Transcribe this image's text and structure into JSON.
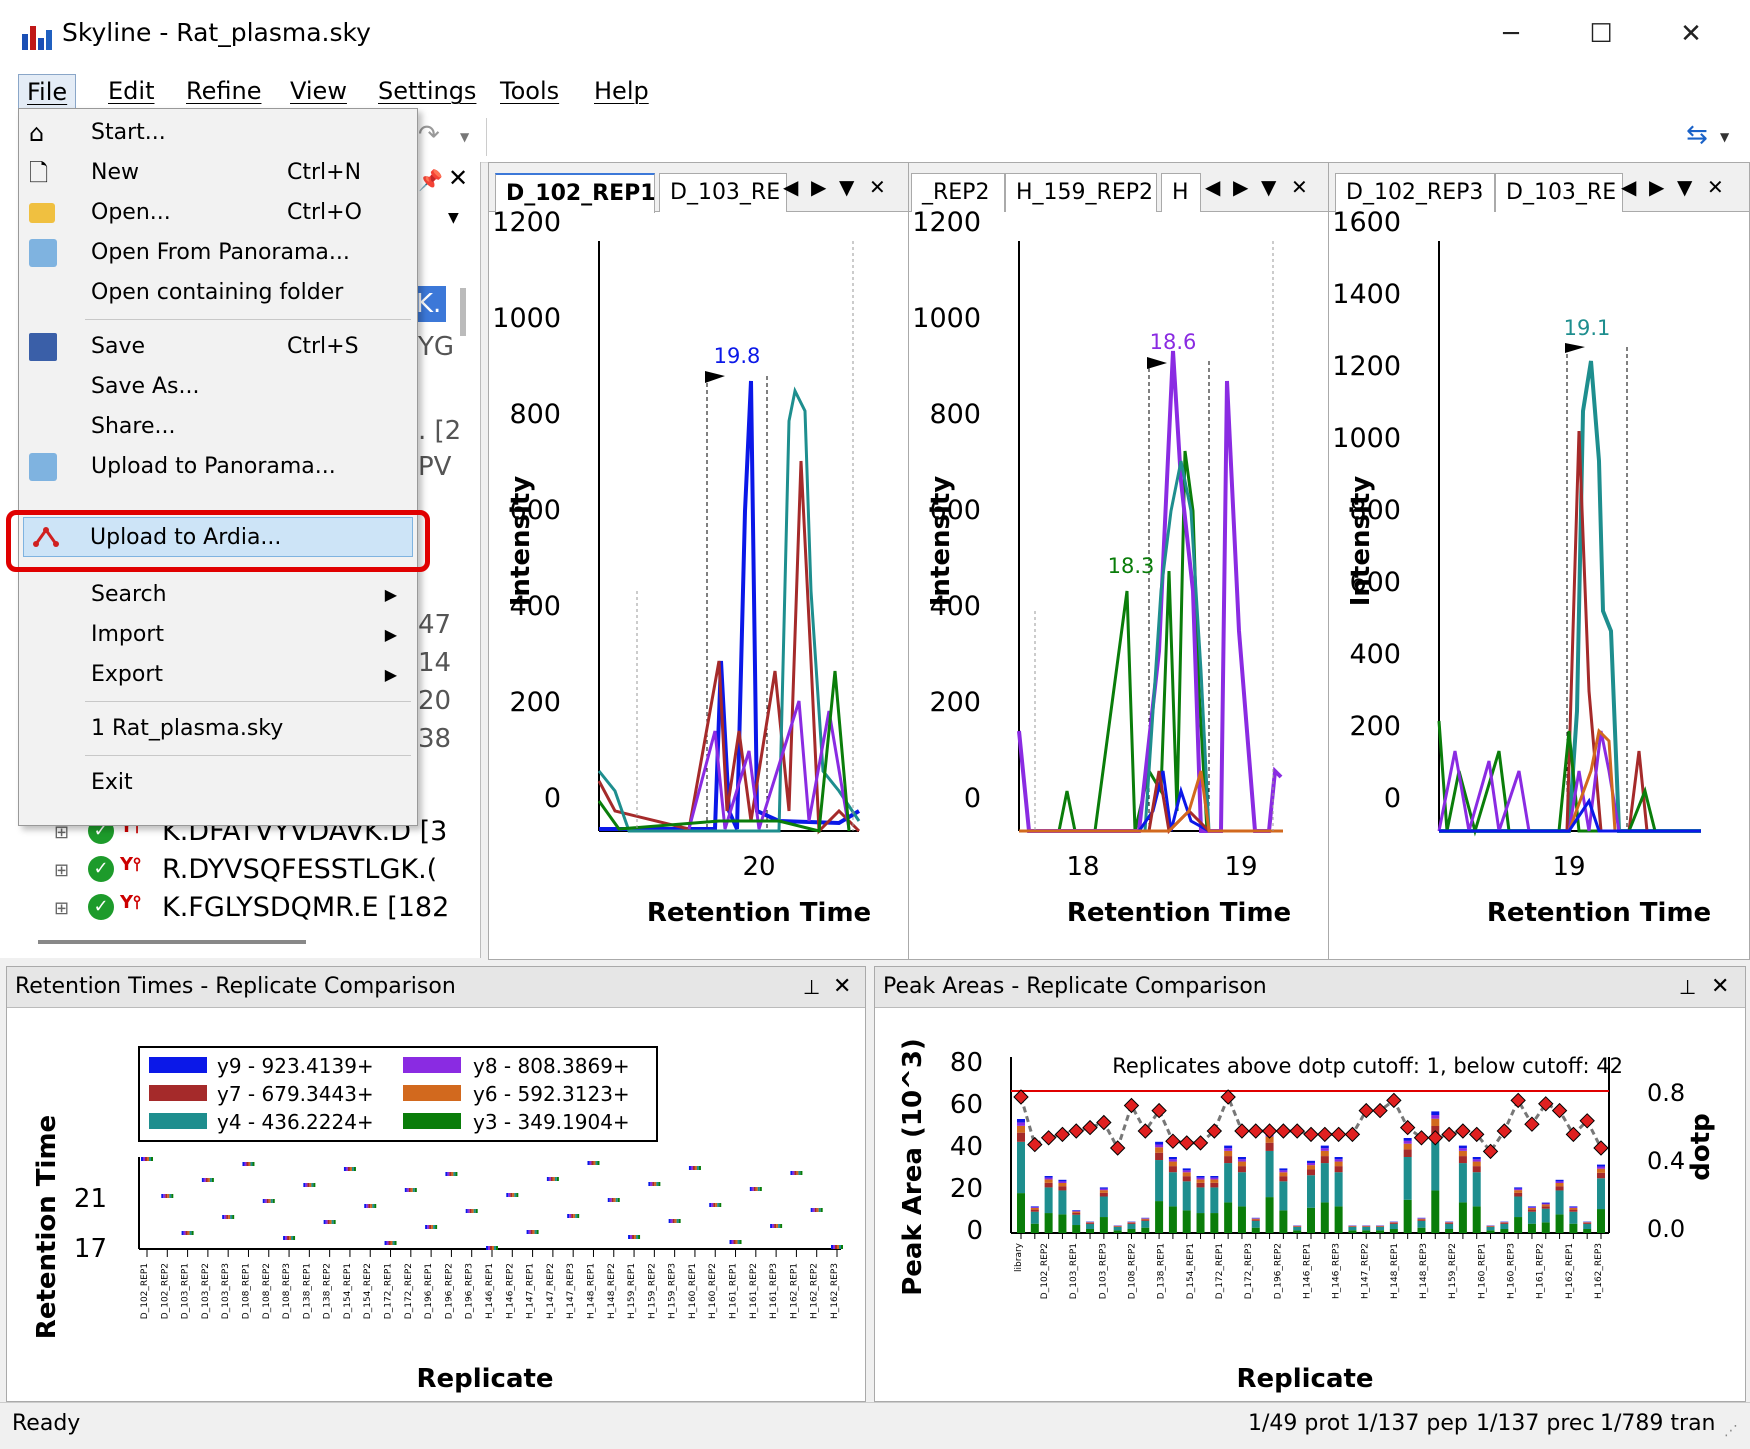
{
  "window": {
    "title": "Skyline - Rat_plasma.sky",
    "controls": [
      "─",
      "☐",
      "✕"
    ]
  },
  "menubar": [
    "File",
    "Edit",
    "Refine",
    "View",
    "Settings",
    "Tools",
    "Help"
  ],
  "file_menu": {
    "items": [
      {
        "label": "Start...",
        "shortcut": "",
        "icon": "home-icon"
      },
      {
        "label": "New",
        "shortcut": "Ctrl+N",
        "icon": "new-document-icon"
      },
      {
        "label": "Open...",
        "shortcut": "Ctrl+O",
        "icon": "open-folder-icon"
      },
      {
        "label": "Open From Panorama...",
        "shortcut": "",
        "icon": "panorama-open-icon"
      },
      {
        "label": "Open containing folder",
        "shortcut": "",
        "icon": ""
      },
      {
        "label": "Save",
        "shortcut": "Ctrl+S",
        "icon": "save-disk-icon"
      },
      {
        "label": "Save As...",
        "shortcut": "",
        "icon": ""
      },
      {
        "label": "Share...",
        "shortcut": "",
        "icon": ""
      },
      {
        "label": "Upload to Panorama...",
        "shortcut": "",
        "icon": "panorama-upload-icon"
      },
      {
        "label": "Upload to Ardia...",
        "shortcut": "",
        "icon": "ardia-icon",
        "highlighted": true
      },
      {
        "label": "Search",
        "shortcut": "",
        "submenu": true
      },
      {
        "label": "Import",
        "shortcut": "",
        "submenu": true
      },
      {
        "label": "Export",
        "shortcut": "",
        "submenu": true
      },
      {
        "label": "1 Rat_plasma.sky",
        "shortcut": ""
      },
      {
        "label": "Exit",
        "shortcut": ""
      }
    ],
    "submenu_arrow": "▶"
  },
  "tree": {
    "visible_rows": [
      {
        "text": "K.DFATVYVDAVK.D [3"
      },
      {
        "text": "R.DYVSQFESSTLGK.("
      },
      {
        "text": "K.FGLYSDQMR.E [182"
      }
    ],
    "clipped_fragments": [
      "K.",
      "YG",
      ". [2",
      "PV",
      "47",
      "14",
      "20",
      "38"
    ],
    "expander": "⊞"
  },
  "graph_panes": [
    {
      "tabs": [
        "D_102_REP1",
        "D_103_RE"
      ],
      "y_title": "Intensity",
      "x_title": "Retention Time",
      "peak_label": "19.8",
      "y_ticks": [
        "1200",
        "1000",
        "800",
        "600",
        "400",
        "200",
        "0"
      ],
      "x_ticks": [
        "20"
      ]
    },
    {
      "tabs": [
        "_REP2",
        "H_159_REP2",
        "H"
      ],
      "y_title": "Intensity",
      "x_title": "Retention Time",
      "peak_label": "18.6",
      "peak_label_2": "18.3",
      "y_ticks": [
        "1200",
        "1000",
        "800",
        "600",
        "400",
        "200",
        "0"
      ],
      "x_ticks": [
        "18",
        "19"
      ]
    },
    {
      "tabs": [
        "D_102_REP3",
        "D_103_RE"
      ],
      "y_title": "Intensity",
      "x_title": "Retention Time",
      "peak_label": "19.1",
      "y_ticks": [
        "1600",
        "1400",
        "1200",
        "1000",
        "800",
        "600",
        "400",
        "200",
        "0"
      ],
      "x_ticks": [
        "19"
      ]
    }
  ],
  "tab_controls": [
    "◀",
    "▶",
    "▼",
    "✕"
  ],
  "rt_panel": {
    "title": "Retention Times - Replicate Comparison",
    "y_title": "Retention Time",
    "x_title": "Replicate",
    "y_ticks": [
      "21",
      "17"
    ],
    "legend": [
      {
        "label": "y9 - 923.4139+",
        "color": "#0b18e8"
      },
      {
        "label": "y8 - 808.3869+",
        "color": "#8a2be2"
      },
      {
        "label": "y7 - 679.3443+",
        "color": "#a52a2a"
      },
      {
        "label": "y6 - 592.3123+",
        "color": "#d2691e"
      },
      {
        "label": "y4 - 436.2224+",
        "color": "#1e8e8e"
      },
      {
        "label": "y3 - 349.1904+",
        "color": "#0a7d0a"
      }
    ],
    "replicates": [
      "D_102_REP1",
      "D_102_REP2",
      "D_103_REP1",
      "D_103_REP2",
      "D_103_REP3",
      "D_108_REP1",
      "D_108_REP2",
      "D_108_REP3",
      "D_138_REP1",
      "D_138_REP2",
      "D_154_REP1",
      "D_154_REP2",
      "D_172_REP1",
      "D_172_REP2",
      "D_196_REP1",
      "D_196_REP2",
      "D_196_REP3",
      "H_146_REP1",
      "H_146_REP2",
      "H_147_REP1",
      "H_147_REP2",
      "H_147_REP3",
      "H_148_REP1",
      "H_148_REP2",
      "H_159_REP1",
      "H_159_REP2",
      "H_159_REP3",
      "H_160_REP1",
      "H_160_REP2",
      "H_161_REP1",
      "H_161_REP2",
      "H_161_REP3",
      "H_162_REP1",
      "H_162_REP2",
      "H_162_REP3"
    ]
  },
  "pa_panel": {
    "title": "Peak Areas - Replicate Comparison",
    "y_title": "Peak Area (10^3)",
    "y2_title": "dotp",
    "x_title": "Replicate",
    "annotation": "Replicates above dotp cutoff: 1, below cutoff: 42",
    "y_ticks": [
      "80",
      "60",
      "40",
      "20",
      "0"
    ],
    "y2_ticks": [
      "0.8",
      "0.4",
      "0.0"
    ],
    "first_category": "library",
    "replicates": [
      "D_102_REP2",
      "D_103_REP1",
      "D_103_REP3",
      "D_108_REP2",
      "D_138_REP1",
      "D_154_REP1",
      "D_172_REP1",
      "D_172_REP3",
      "D_196_REP2",
      "H_146_REP1",
      "H_146_REP3",
      "H_147_REP2",
      "H_148_REP1",
      "H_148_REP3",
      "H_159_REP2",
      "H_160_REP1",
      "H_160_REP3",
      "H_161_REP2",
      "H_162_REP1",
      "H_162_REP3"
    ]
  },
  "status": {
    "left": "Ready",
    "prot": "1/49 prot",
    "pep": "1/137 pep",
    "prec": "1/137 prec",
    "tran": "1/789 tran"
  },
  "colors": {
    "y9": "#0b18e8",
    "y8": "#8a2be2",
    "y7": "#a52a2a",
    "y6": "#d2691e",
    "y4": "#1e8e8e",
    "y3": "#0a7d0a",
    "highlight_box": "#e00000"
  }
}
